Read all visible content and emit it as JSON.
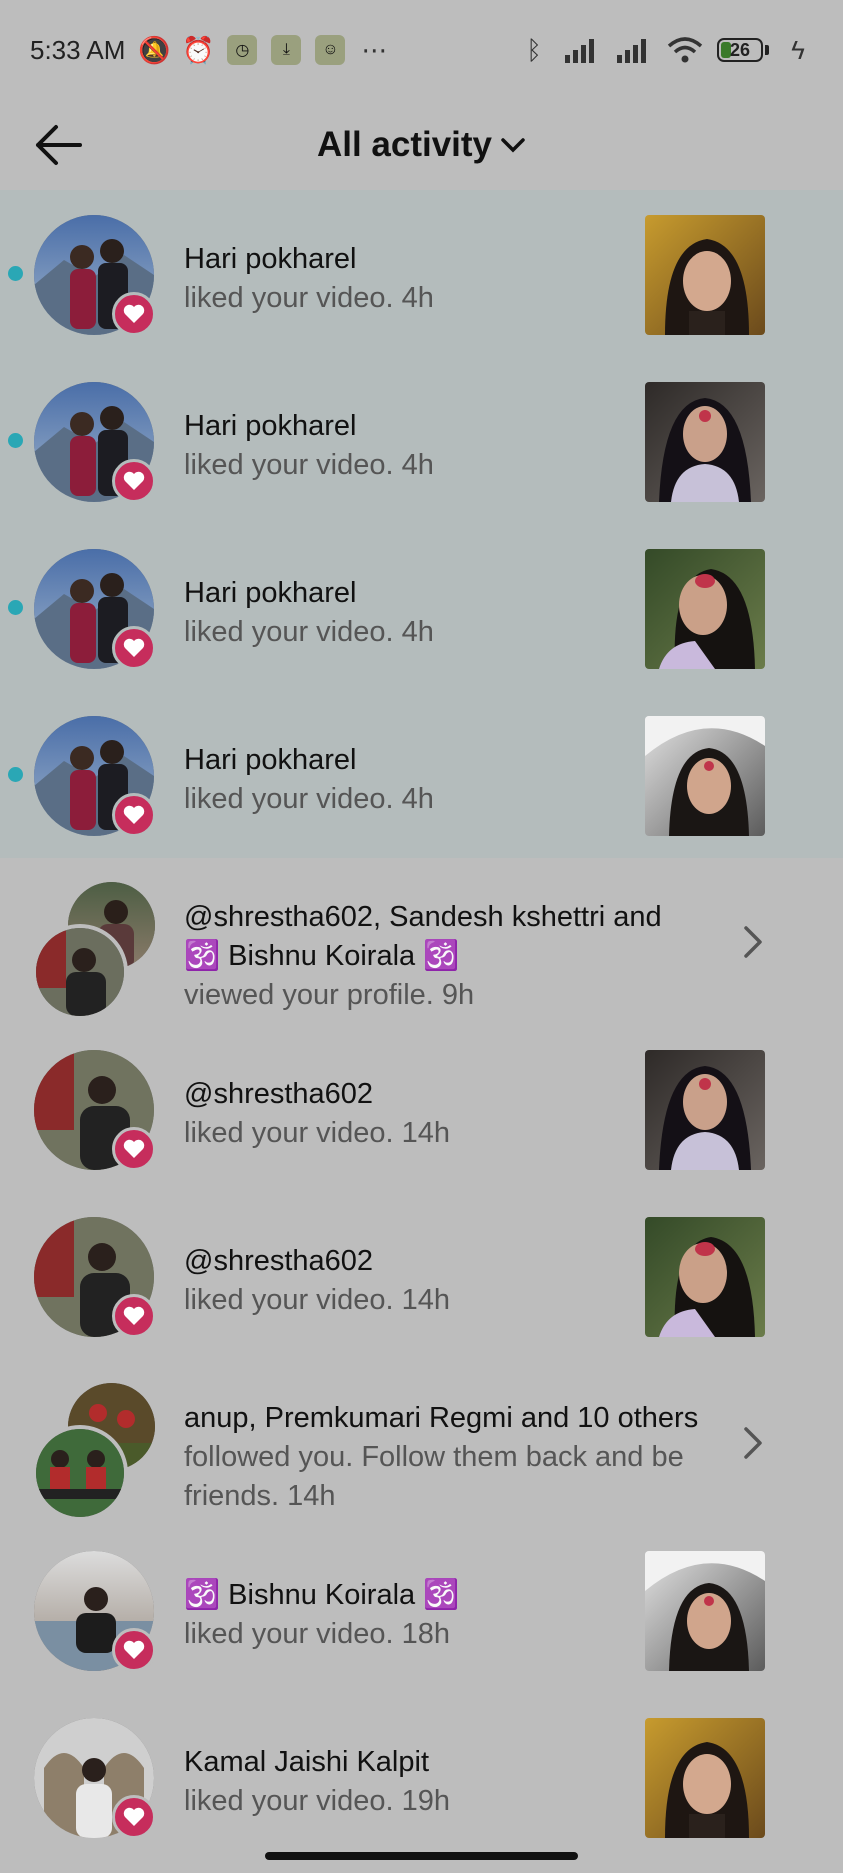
{
  "status_bar": {
    "time": "5:33 AM",
    "battery": "26"
  },
  "header": {
    "title": "All activity"
  },
  "notifications": [
    {
      "name": "Hari pokharel",
      "action": "liked your video.",
      "time": "4h"
    },
    {
      "name": "Hari pokharel",
      "action": "liked your video.",
      "time": "4h"
    },
    {
      "name": "Hari pokharel",
      "action": "liked your video.",
      "time": "4h"
    },
    {
      "name": "Hari pokharel",
      "action": "liked your video.",
      "time": "4h"
    },
    {
      "line1": "@shrestha602, Sandesh kshettri and",
      "line2": "🕉️ Bishnu Koirala 🕉️",
      "action": "viewed your profile.",
      "time": "9h"
    },
    {
      "name": "@shrestha602",
      "action": "liked your video.",
      "time": "14h"
    },
    {
      "name": "@shrestha602",
      "action": "liked your video.",
      "time": "14h"
    },
    {
      "line1": "anup, Premkumari Regmi and 10 others",
      "line2": "followed you. Follow them back and be",
      "action": "friends.",
      "time": "14h"
    },
    {
      "name": "🕉️ Bishnu Koirala 🕉️",
      "action": "liked your video.",
      "time": "18h"
    },
    {
      "name": "Kamal Jaishi Kalpit",
      "action": "liked your video.",
      "time": "19h"
    }
  ],
  "colors": {
    "accent_dot": "#2aa7b5",
    "heart": "#c62d5c",
    "background": "#bdbdbd",
    "unread_bg": "#b4bcbc"
  }
}
